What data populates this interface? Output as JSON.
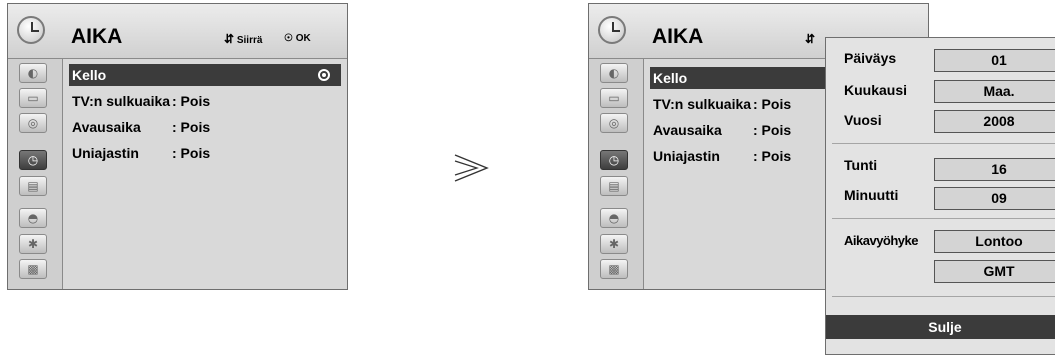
{
  "left_menu": {
    "title": "AIKA",
    "hint_move": "Siirrä",
    "hint_ok": "OK",
    "items": [
      {
        "label": "Kello",
        "value": ""
      },
      {
        "label": "TV:n sulkuaika",
        "value": ": Pois"
      },
      {
        "label": "Avausaika",
        "value": ": Pois"
      },
      {
        "label": "Uniajastin",
        "value": ": Pois"
      }
    ],
    "sidebar_icons": [
      "satellite-dish-icon",
      "tv-screen-icon",
      "speaker-icon",
      "clock-icon",
      "toolbox-icon",
      "lock-icon",
      "bluetooth-icon",
      "clapperboard-icon"
    ]
  },
  "right_menu": {
    "title": "AIKA",
    "items": [
      {
        "label": "Kello",
        "value": ""
      },
      {
        "label": "TV:n sulkuaika",
        "value": ": Pois"
      },
      {
        "label": "Avausaika",
        "value": ": Pois"
      },
      {
        "label": "Uniajastin",
        "value": ": Pois"
      }
    ]
  },
  "clock_popup": {
    "fields": [
      {
        "label": "Päiväys",
        "value": "01"
      },
      {
        "label": "Kuukausi",
        "value": "Maa."
      },
      {
        "label": "Vuosi",
        "value": "2008"
      },
      {
        "label": "Tunti",
        "value": "16"
      },
      {
        "label": "Minuutti",
        "value": "09"
      },
      {
        "label": "Aikavyöhyke",
        "value": "Lontoo"
      },
      {
        "label": "",
        "value": "GMT"
      }
    ],
    "close_label": "Sulje"
  },
  "colors": {
    "panel": "#d9d9d9",
    "header": "#e0e0e0",
    "selected": "#3b3b3b",
    "popup": "#e3e3e3"
  }
}
